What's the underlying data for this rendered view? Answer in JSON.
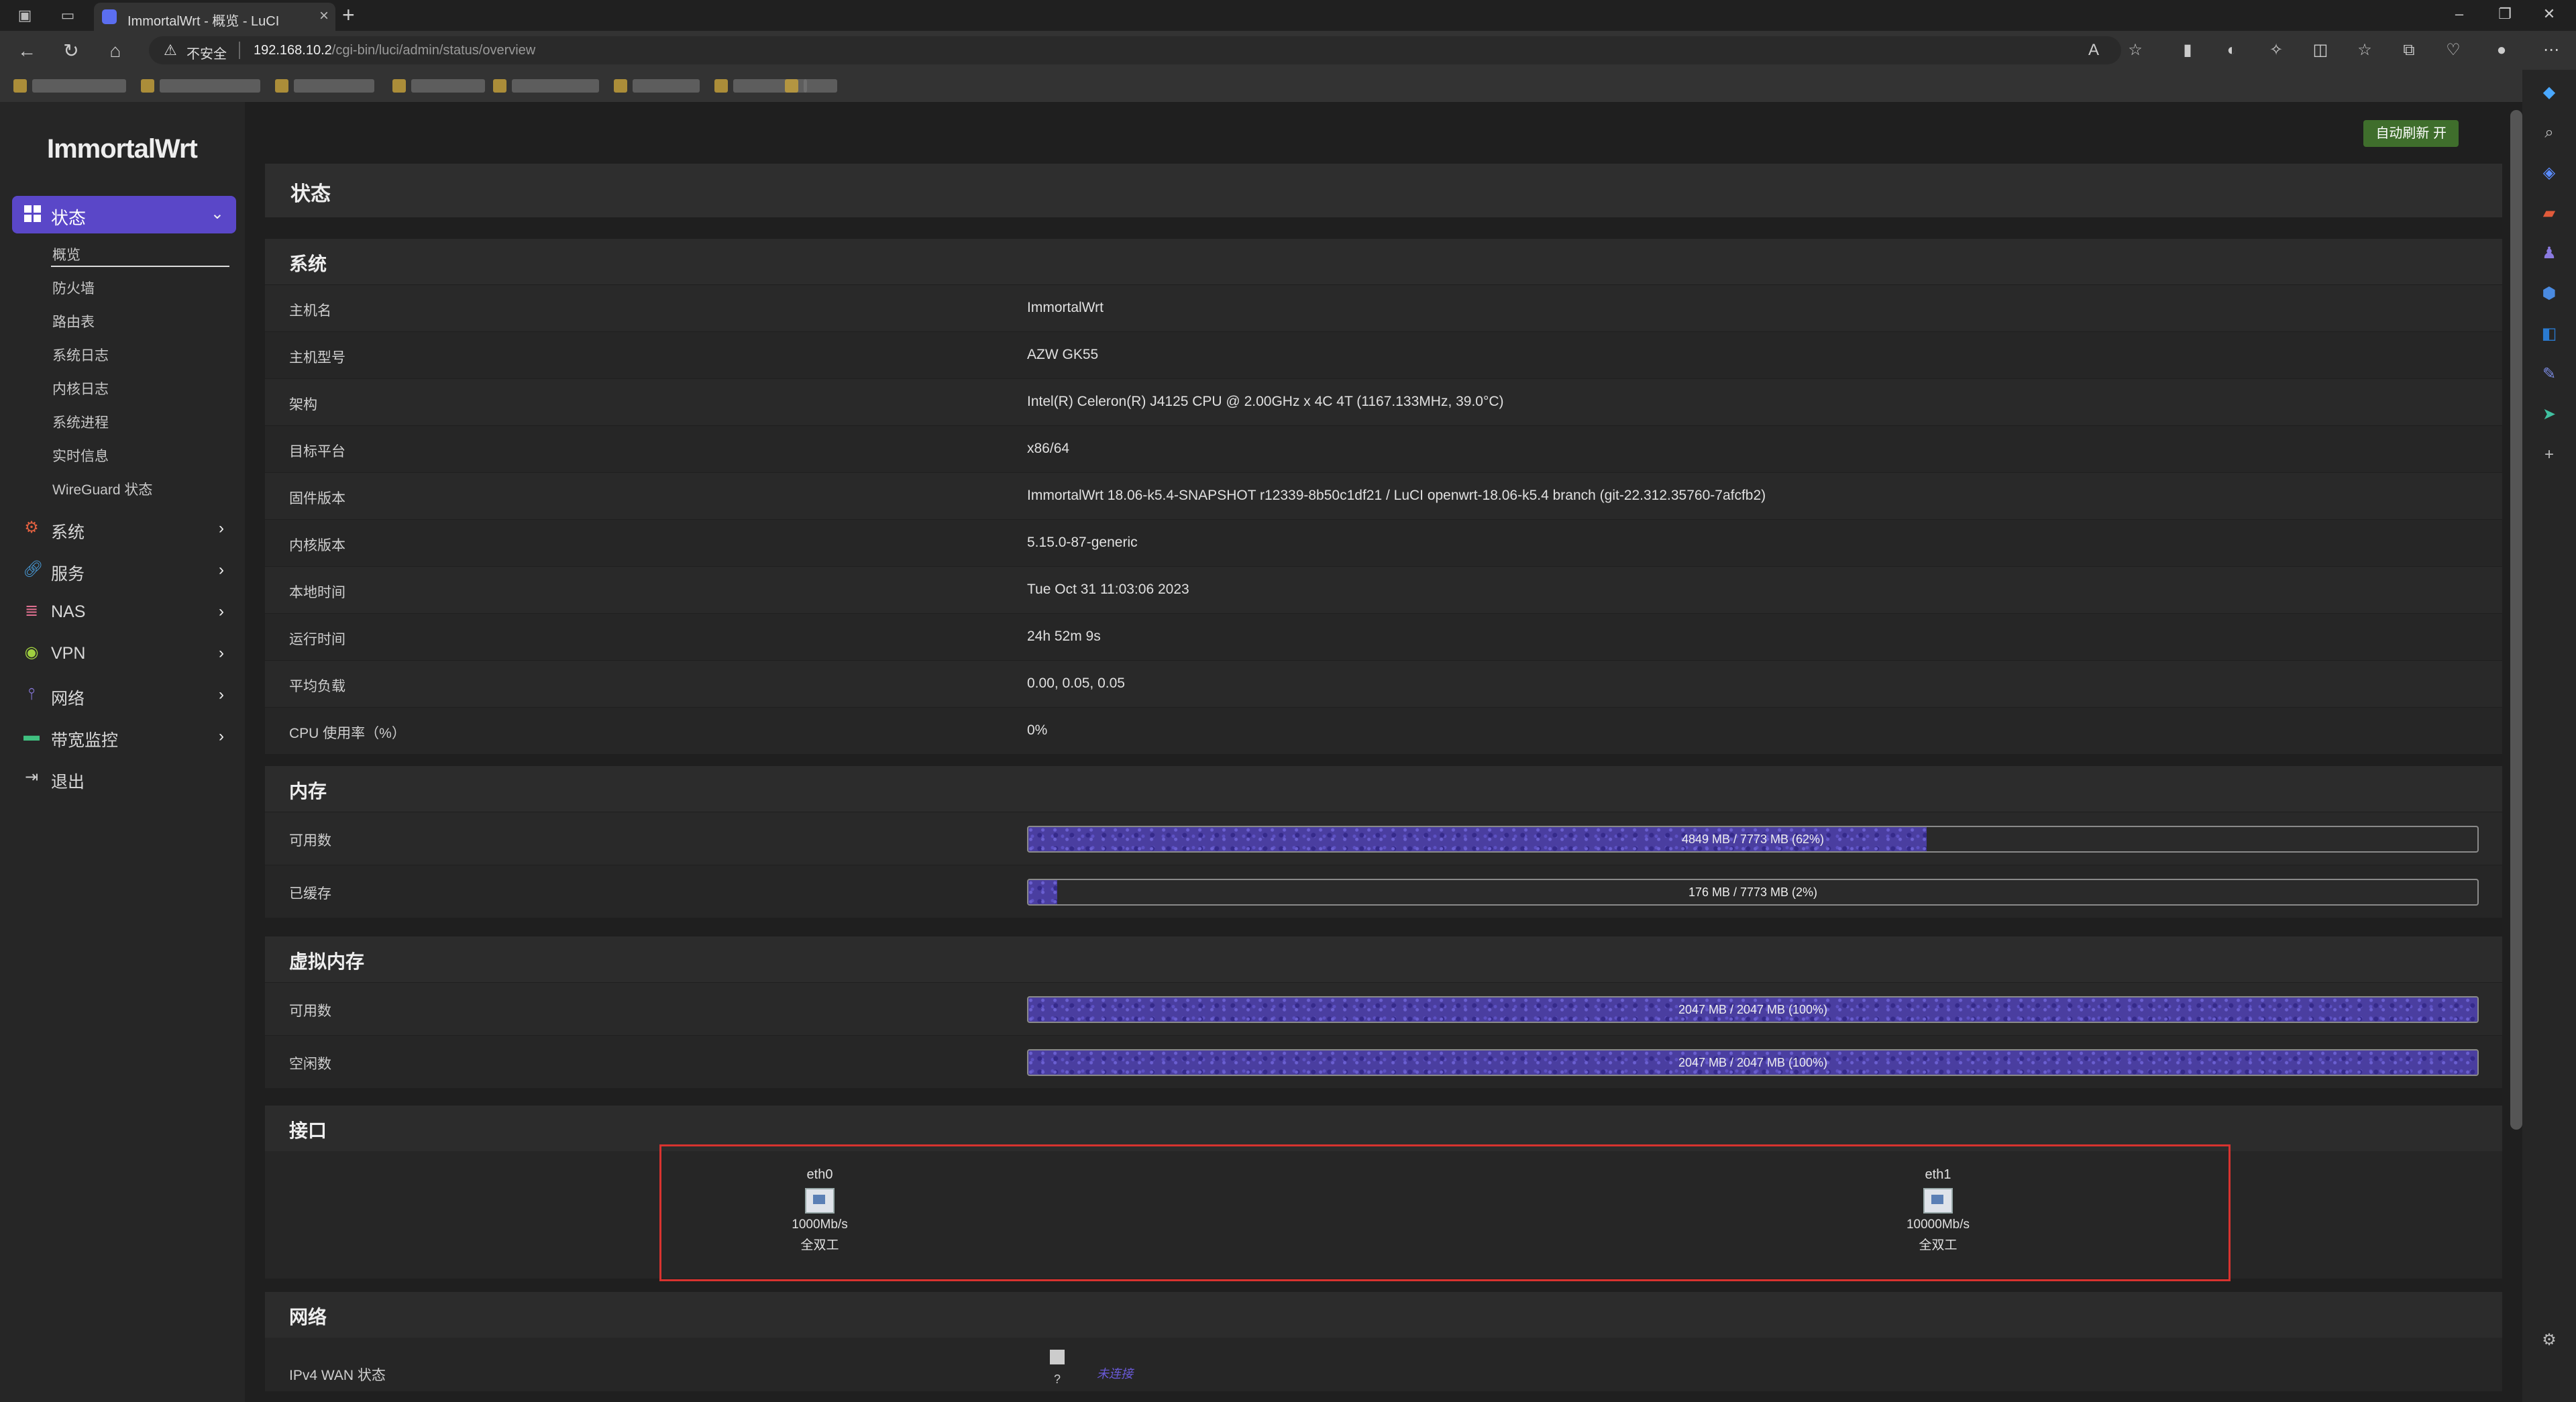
{
  "browser": {
    "tab_title": "ImmortalWrt - 概览 - LuCI",
    "security_label": "不安全",
    "url_host": "192.168.10.2",
    "url_path": "/cgi-bin/luci/admin/status/overview"
  },
  "sidebar": {
    "logo": "ImmortalWrt",
    "active_menu": "状态",
    "submenu": [
      "概览",
      "防火墙",
      "路由表",
      "系统日志",
      "内核日志",
      "系统进程",
      "实时信息",
      "WireGuard 状态"
    ],
    "menus": [
      {
        "label": "系统",
        "icon": "gear-icon",
        "color": "#e06040"
      },
      {
        "label": "服务",
        "icon": "link-icon",
        "color": "#4aa0e0"
      },
      {
        "label": "NAS",
        "icon": "database-icon",
        "color": "#e07090"
      },
      {
        "label": "VPN",
        "icon": "shield-icon",
        "color": "#a0d040"
      },
      {
        "label": "网络",
        "icon": "network-icon",
        "color": "#8a7ae0"
      },
      {
        "label": "带宽监控",
        "icon": "monitor-icon",
        "color": "#40c080"
      },
      {
        "label": "退出",
        "icon": "logout-icon",
        "color": "#cccccc"
      }
    ]
  },
  "header": {
    "auto_refresh": "自动刷新 开",
    "page_title": "状态"
  },
  "system": {
    "title": "系统",
    "rows": [
      {
        "key": "主机名",
        "value": "ImmortalWrt"
      },
      {
        "key": "主机型号",
        "value": "AZW GK55"
      },
      {
        "key": "架构",
        "value": "Intel(R) Celeron(R) J4125 CPU @ 2.00GHz x 4C 4T (1167.133MHz, 39.0°C)"
      },
      {
        "key": "目标平台",
        "value": "x86/64"
      },
      {
        "key": "固件版本",
        "value": "ImmortalWrt 18.06-k5.4-SNAPSHOT r12339-8b50c1df21 / LuCI openwrt-18.06-k5.4 branch (git-22.312.35760-7afcfb2)"
      },
      {
        "key": "内核版本",
        "value": "5.15.0-87-generic"
      },
      {
        "key": "本地时间",
        "value": "Tue Oct 31 11:03:06 2023"
      },
      {
        "key": "运行时间",
        "value": "24h 52m 9s"
      },
      {
        "key": "平均负载",
        "value": "0.00, 0.05, 0.05"
      },
      {
        "key": "CPU 使用率（%）",
        "value": "0%"
      }
    ]
  },
  "memory": {
    "title": "内存",
    "rows": [
      {
        "key": "可用数",
        "text": "4849 MB / 7773 MB (62%)",
        "fraction": 0.62
      },
      {
        "key": "已缓存",
        "text": "176 MB / 7773 MB (2%)",
        "fraction": 0.02
      }
    ]
  },
  "swap": {
    "title": "虚拟内存",
    "rows": [
      {
        "key": "可用数",
        "text": "2047 MB / 2047 MB (100%)",
        "fraction": 1.0
      },
      {
        "key": "空闲数",
        "text": "2047 MB / 2047 MB (100%)",
        "fraction": 1.0
      }
    ]
  },
  "interfaces": {
    "title": "接口",
    "ports": [
      {
        "name": "eth0",
        "speed": "1000Mb/s",
        "duplex": "全双工"
      },
      {
        "name": "eth1",
        "speed": "10000Mb/s",
        "duplex": "全双工"
      }
    ]
  },
  "network": {
    "title": "网络",
    "wan_label": "IPv4 WAN 状态",
    "wan_q": "?",
    "wan_status": "未连接"
  }
}
